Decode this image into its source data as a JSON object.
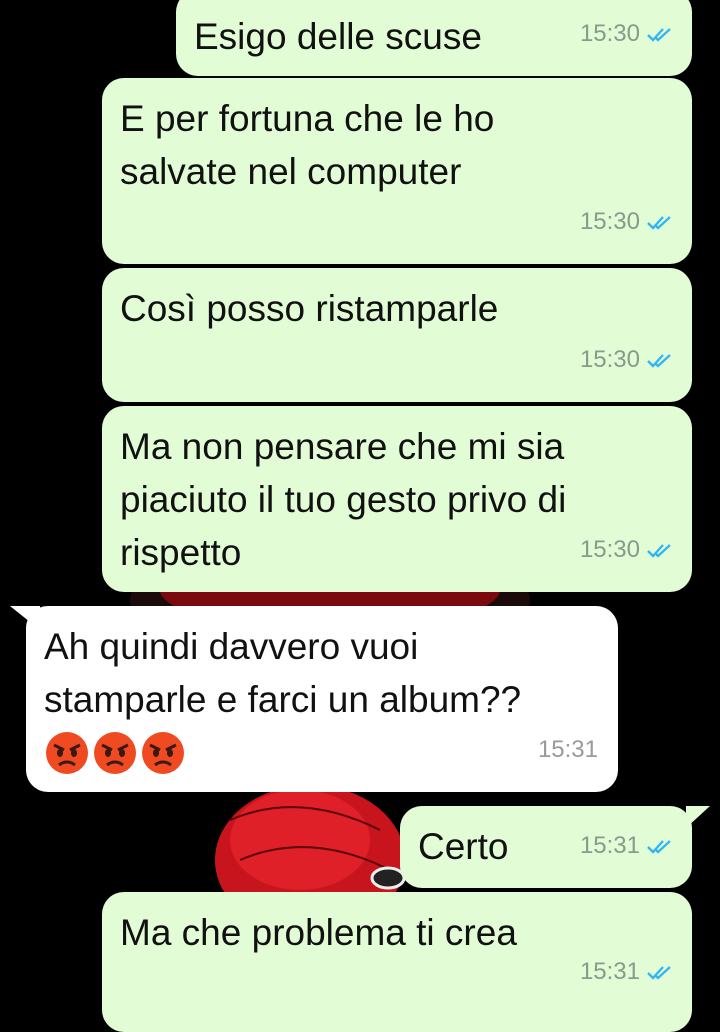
{
  "chat": {
    "messages": [
      {
        "id": "m1",
        "dir": "out",
        "text": "Esigo delle scuse",
        "time": "15:30",
        "status": "read"
      },
      {
        "id": "m2",
        "dir": "out",
        "text": "E per fortuna che le ho\nsalvate nel computer",
        "time": "15:30",
        "status": "read"
      },
      {
        "id": "m3",
        "dir": "out",
        "text": "Così posso ristamparle",
        "time": "15:30",
        "status": "read"
      },
      {
        "id": "m4",
        "dir": "out",
        "text": "Ma non pensare che mi sia\npiaciuto il tuo gesto privo di\nrispetto",
        "time": "15:30",
        "status": "read"
      },
      {
        "id": "m5",
        "dir": "in",
        "text": "Ah quindi davvero vuoi\nstamparle e farci un album??",
        "emoji": [
          "angry-face",
          "angry-face",
          "angry-face"
        ],
        "time": "15:31"
      },
      {
        "id": "m6",
        "dir": "out",
        "text": "Certo",
        "time": "15:31",
        "status": "read"
      },
      {
        "id": "m7",
        "dir": "out",
        "text": "Ma che problema ti crea",
        "time": "15:31",
        "status": "read"
      }
    ]
  },
  "colors": {
    "outgoing_bubble": "#e2fcd6",
    "incoming_bubble": "#ffffff",
    "read_ticks": "#34b7f1",
    "background": "#000000",
    "wallpaper_accent": "#c8141c"
  }
}
